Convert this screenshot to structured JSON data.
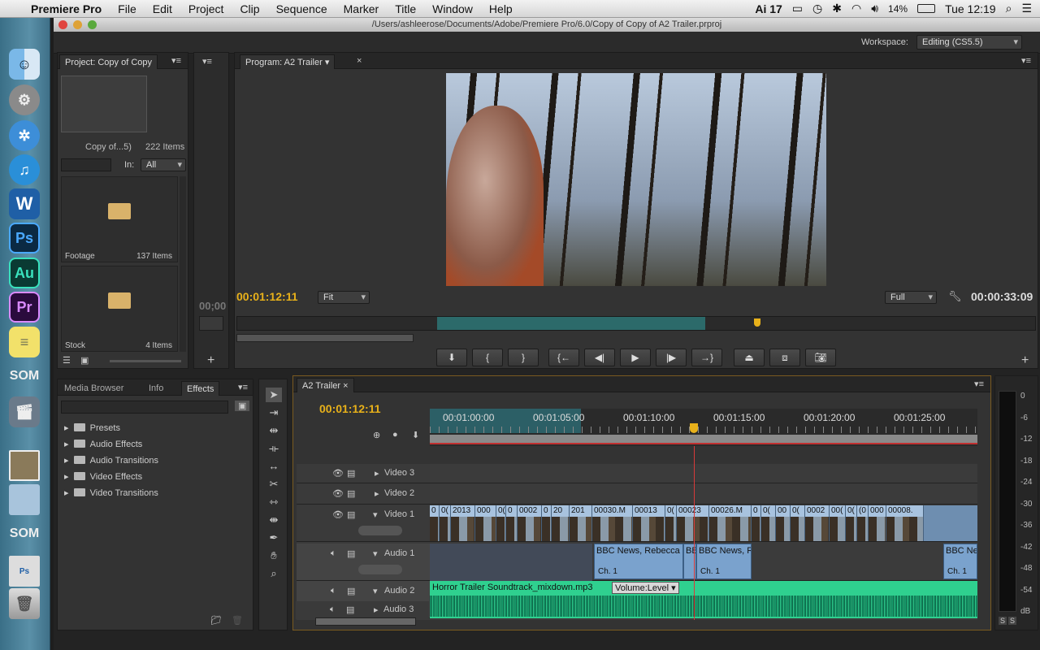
{
  "menubar": {
    "app_name": "Premiere Pro",
    "items": [
      "File",
      "Edit",
      "Project",
      "Clip",
      "Sequence",
      "Marker",
      "Title",
      "Window",
      "Help"
    ],
    "status": {
      "ai_badge": "17",
      "battery": "14%",
      "clock": "Tue 12:19"
    }
  },
  "window": {
    "title": "/Users/ashleerose/Documents/Adobe/Premiere Pro/6.0/Copy of Copy of A2 Trailer.prproj",
    "workspace_label": "Workspace:",
    "workspace_value": "Editing (CS5.5)"
  },
  "project": {
    "tab": "Project: Copy of Copy",
    "name": "Copy of...5)",
    "count": "222 Items",
    "in_label": "In:",
    "in_value": "All",
    "bins": [
      {
        "name": "Footage",
        "count": "137 Items"
      },
      {
        "name": "Stock",
        "count": "4 Items"
      }
    ]
  },
  "source": {
    "timecode": "00;00"
  },
  "program": {
    "tab": "Program: A2 Trailer",
    "timecode": "00:01:12:11",
    "fit": "Fit",
    "quality": "Full",
    "duration": "00:00:33:09"
  },
  "effects": {
    "tabs": [
      "Media Browser",
      "Info",
      "Effects"
    ],
    "items": [
      "Presets",
      "Audio Effects",
      "Audio Transitions",
      "Video Effects",
      "Video Transitions"
    ]
  },
  "timeline": {
    "tab": "A2 Trailer",
    "timecode": "00:01:12:11",
    "ruler": [
      "00:01:00:00",
      "00:01:05:00",
      "00:01:10:00",
      "00:01:15:00",
      "00:01:20:00",
      "00:01:25:00"
    ],
    "tracks": {
      "v3": "Video 3",
      "v2": "Video 2",
      "v1": "Video 1",
      "a1": "Audio 1",
      "a2": "Audio 2",
      "a3": "Audio 3"
    },
    "video_clips": [
      "0",
      "0(",
      "2013",
      "000",
      "0(",
      "0",
      "0002",
      "0",
      "20",
      "201",
      "00030.M",
      "00013",
      "0(",
      "00023",
      "00026.M",
      "0",
      "0(",
      "00",
      "0(",
      "0002",
      "00(",
      "0(",
      "(0",
      "000",
      "00008."
    ],
    "audio1_clips": [
      "BBC News, Rebecca",
      "BB",
      "BBC News, R",
      "BBC Ne"
    ],
    "audio1_channel": "Ch. 1",
    "audio2_clip": "Horror Trailer Soundtrack_mixdown.mp3",
    "audio2_fx": "Volume:Level"
  },
  "vu_meter": {
    "labels": [
      "0",
      "-6",
      "-12",
      "-18",
      "-24",
      "-30",
      "-36",
      "-42",
      "-48",
      "-54",
      "dB"
    ],
    "solo": "S"
  }
}
